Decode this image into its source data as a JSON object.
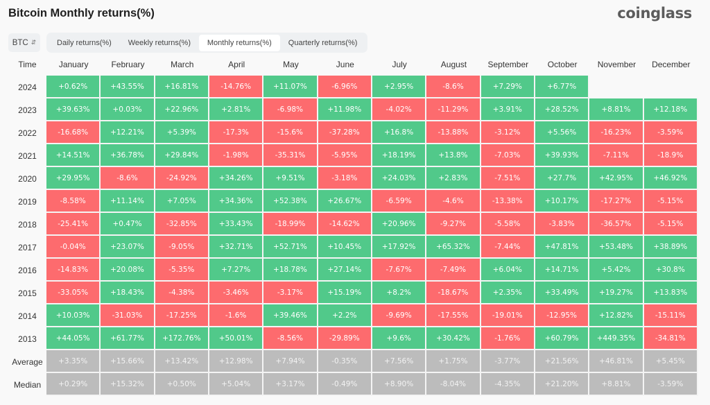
{
  "title": "Bitcoin Monthly returns(%)",
  "brand": "coinglass",
  "coin_select": {
    "value": "BTC",
    "icon": "updown-chevron-icon"
  },
  "tabs": [
    {
      "label": "Daily returns(%)",
      "active": false
    },
    {
      "label": "Weekly returns(%)",
      "active": false
    },
    {
      "label": "Monthly returns(%)",
      "active": true
    },
    {
      "label": "Quarterly returns(%)",
      "active": false
    }
  ],
  "colors": {
    "positive": "#51c98a",
    "negative": "#fd6b6e",
    "stat": "#bcbcbc"
  },
  "chart_data": {
    "type": "table",
    "title": "Bitcoin Monthly returns(%)",
    "row_header": "Time",
    "columns": [
      "January",
      "February",
      "March",
      "April",
      "May",
      "June",
      "July",
      "August",
      "September",
      "October",
      "November",
      "December"
    ],
    "rows": [
      {
        "label": "2024",
        "values": [
          "+0.62%",
          "+43.55%",
          "+16.81%",
          "-14.76%",
          "+11.07%",
          "-6.96%",
          "+2.95%",
          "-8.6%",
          "+7.29%",
          "+6.77%",
          null,
          null
        ]
      },
      {
        "label": "2023",
        "values": [
          "+39.63%",
          "+0.03%",
          "+22.96%",
          "+2.81%",
          "-6.98%",
          "+11.98%",
          "-4.02%",
          "-11.29%",
          "+3.91%",
          "+28.52%",
          "+8.81%",
          "+12.18%"
        ]
      },
      {
        "label": "2022",
        "values": [
          "-16.68%",
          "+12.21%",
          "+5.39%",
          "-17.3%",
          "-15.6%",
          "-37.28%",
          "+16.8%",
          "-13.88%",
          "-3.12%",
          "+5.56%",
          "-16.23%",
          "-3.59%"
        ]
      },
      {
        "label": "2021",
        "values": [
          "+14.51%",
          "+36.78%",
          "+29.84%",
          "-1.98%",
          "-35.31%",
          "-5.95%",
          "+18.19%",
          "+13.8%",
          "-7.03%",
          "+39.93%",
          "-7.11%",
          "-18.9%"
        ]
      },
      {
        "label": "2020",
        "values": [
          "+29.95%",
          "-8.6%",
          "-24.92%",
          "+34.26%",
          "+9.51%",
          "-3.18%",
          "+24.03%",
          "+2.83%",
          "-7.51%",
          "+27.7%",
          "+42.95%",
          "+46.92%"
        ]
      },
      {
        "label": "2019",
        "values": [
          "-8.58%",
          "+11.14%",
          "+7.05%",
          "+34.36%",
          "+52.38%",
          "+26.67%",
          "-6.59%",
          "-4.6%",
          "-13.38%",
          "+10.17%",
          "-17.27%",
          "-5.15%"
        ]
      },
      {
        "label": "2018",
        "values": [
          "-25.41%",
          "+0.47%",
          "-32.85%",
          "+33.43%",
          "-18.99%",
          "-14.62%",
          "+20.96%",
          "-9.27%",
          "-5.58%",
          "-3.83%",
          "-36.57%",
          "-5.15%"
        ]
      },
      {
        "label": "2017",
        "values": [
          "-0.04%",
          "+23.07%",
          "-9.05%",
          "+32.71%",
          "+52.71%",
          "+10.45%",
          "+17.92%",
          "+65.32%",
          "-7.44%",
          "+47.81%",
          "+53.48%",
          "+38.89%"
        ]
      },
      {
        "label": "2016",
        "values": [
          "-14.83%",
          "+20.08%",
          "-5.35%",
          "+7.27%",
          "+18.78%",
          "+27.14%",
          "-7.67%",
          "-7.49%",
          "+6.04%",
          "+14.71%",
          "+5.42%",
          "+30.8%"
        ]
      },
      {
        "label": "2015",
        "values": [
          "-33.05%",
          "+18.43%",
          "-4.38%",
          "-3.46%",
          "-3.17%",
          "+15.19%",
          "+8.2%",
          "-18.67%",
          "+2.35%",
          "+33.49%",
          "+19.27%",
          "+13.83%"
        ]
      },
      {
        "label": "2014",
        "values": [
          "+10.03%",
          "-31.03%",
          "-17.25%",
          "-1.6%",
          "+39.46%",
          "+2.2%",
          "-9.69%",
          "-17.55%",
          "-19.01%",
          "-12.95%",
          "+12.82%",
          "-15.11%"
        ]
      },
      {
        "label": "2013",
        "values": [
          "+44.05%",
          "+61.77%",
          "+172.76%",
          "+50.01%",
          "-8.56%",
          "-29.89%",
          "+9.6%",
          "+30.42%",
          "-1.76%",
          "+60.79%",
          "+449.35%",
          "-34.81%"
        ]
      }
    ],
    "stats": [
      {
        "label": "Average",
        "values": [
          "+3.35%",
          "+15.66%",
          "+13.42%",
          "+12.98%",
          "+7.94%",
          "-0.35%",
          "+7.56%",
          "+1.75%",
          "-3.77%",
          "+21.56%",
          "+46.81%",
          "+5.45%"
        ]
      },
      {
        "label": "Median",
        "values": [
          "+0.29%",
          "+15.32%",
          "+0.50%",
          "+5.04%",
          "+3.17%",
          "-0.49%",
          "+8.90%",
          "-8.04%",
          "-4.35%",
          "+21.20%",
          "+8.81%",
          "-3.59%"
        ]
      }
    ]
  }
}
